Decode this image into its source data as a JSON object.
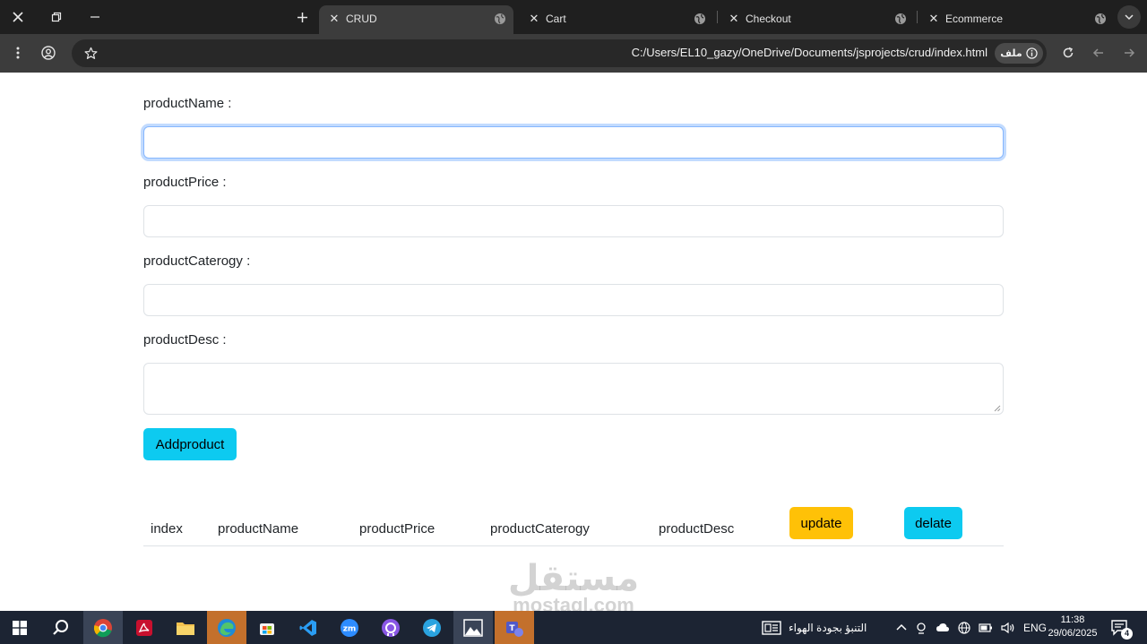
{
  "browser": {
    "tabs": [
      {
        "title": "CRUD",
        "active": true
      },
      {
        "title": "Cart",
        "active": false
      },
      {
        "title": "Checkout",
        "active": false
      },
      {
        "title": "Ecommerce",
        "active": false
      }
    ],
    "address": {
      "url": "C:/Users/EL10_gazy/OneDrive/Documents/jsprojects/crud/index.html",
      "chip_label": "ملف"
    }
  },
  "form": {
    "fields": [
      {
        "label": "productName :",
        "value": "",
        "focused": true
      },
      {
        "label": "productPrice :",
        "value": "",
        "focused": false
      },
      {
        "label": "productCaterogy :",
        "value": "",
        "focused": false
      },
      {
        "label": "productDesc :",
        "value": "",
        "focused": false,
        "multiline": true
      }
    ],
    "add_button": "Addproduct"
  },
  "table": {
    "headers": [
      "index",
      "productName",
      "productPrice",
      "productCaterogy",
      "productDesc"
    ],
    "update_button": "update",
    "delete_button": "delate"
  },
  "watermark": {
    "arabic": "مستقل",
    "latin": "mostaql.com"
  },
  "taskbar": {
    "weather_text": "التنبؤ بجودة الهواء",
    "language": "ENG",
    "time": "11:38",
    "date": "29/06/2025",
    "notifications": "4"
  },
  "colors": {
    "info": "#0dcaf0",
    "warning": "#ffc107",
    "focus": "#86b7fe"
  }
}
